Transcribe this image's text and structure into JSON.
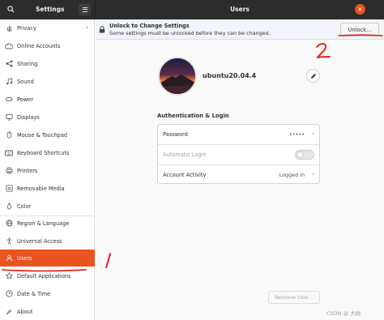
{
  "header": {
    "sidebar_title": "Settings",
    "main_title": "Users",
    "close_glyph": "×"
  },
  "sidebar": {
    "items": [
      {
        "label": "Privacy",
        "icon": "hand-icon",
        "chevron": "›"
      },
      {
        "label": "Online Accounts",
        "icon": "cloud-icon"
      },
      {
        "label": "Sharing",
        "icon": "share-icon"
      },
      {
        "label": "Sound",
        "icon": "music-note-icon"
      },
      {
        "label": "Power",
        "icon": "power-icon"
      },
      {
        "label": "Displays",
        "icon": "display-icon"
      },
      {
        "label": "Mouse & Touchpad",
        "icon": "mouse-icon"
      },
      {
        "label": "Keyboard Shortcuts",
        "icon": "keyboard-icon"
      },
      {
        "label": "Printers",
        "icon": "printer-icon"
      },
      {
        "label": "Removable Media",
        "icon": "media-icon"
      },
      {
        "label": "Color",
        "icon": "color-icon"
      },
      {
        "label": "Region & Language",
        "icon": "globe-icon"
      },
      {
        "label": "Universal Access",
        "icon": "accessibility-icon"
      },
      {
        "label": "Users",
        "icon": "users-icon",
        "active": true
      },
      {
        "label": "Default Applications",
        "icon": "star-icon"
      },
      {
        "label": "Date & Time",
        "icon": "clock-icon"
      },
      {
        "label": "About",
        "icon": "info-icon"
      }
    ]
  },
  "infobar": {
    "title": "Unlock to Change Settings",
    "subtitle": "Some settings must be unlocked before they can be changed.",
    "button_label": "Unlock..."
  },
  "user": {
    "name": "ubuntu20.04.4"
  },
  "auth": {
    "section_title": "Authentication & Login",
    "rows": [
      {
        "label": "Password",
        "value": "•••••",
        "chevron": "›"
      },
      {
        "label": "Automatic Login",
        "toggle": false
      },
      {
        "label": "Account Activity",
        "value": "Logged in",
        "chevron": "›"
      }
    ]
  },
  "footer": {
    "remove_button": "Remove User..."
  },
  "annotations": {
    "mark_1": "1",
    "mark_2": "2"
  },
  "watermark": "CSDN @ 大树",
  "colors": {
    "accent": "#e95420",
    "annotation": "#e8231a",
    "headerbar": "#2c2c2c"
  }
}
